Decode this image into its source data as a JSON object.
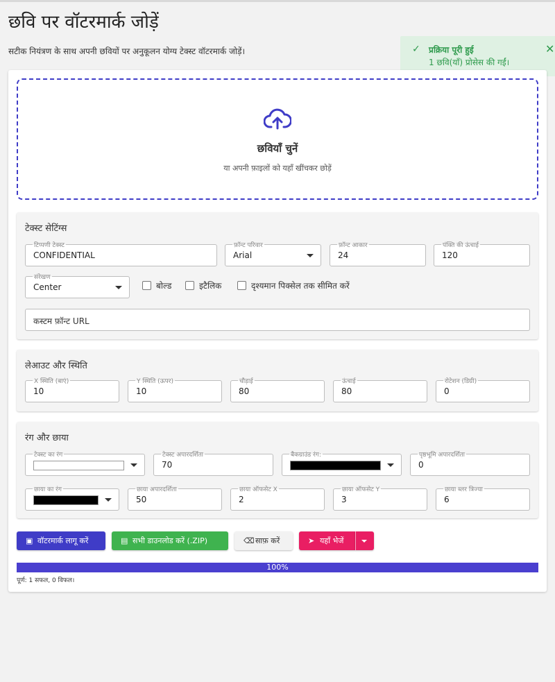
{
  "page": {
    "title": "छवि पर वॉटरमार्क जोड़ें",
    "description": "सटीक नियंत्रण के साथ अपनी छवियों पर अनुकूलन योग्य टेक्स्ट वॉटरमार्क जोड़ें।"
  },
  "toast": {
    "title": "प्रक्रिया पूरी हुई",
    "message": "1 छवि(याँ) प्रोसेस की गईं।",
    "close_icon": "close-icon",
    "check_icon": "check-icon"
  },
  "dropzone": {
    "icon": "cloud-upload-icon",
    "title": "छवियाँ चुनें",
    "subtitle": "या अपनी फ़ाइलों को यहाँ खींचकर छोड़ें"
  },
  "text_settings": {
    "title": "टेक्स्ट सेटिंग्स",
    "comment_text": {
      "label": "टिप्पणी टेक्स्ट",
      "value": "CONFIDENTIAL"
    },
    "font_family": {
      "label": "फ़ॉन्ट परिवार",
      "value": "Arial"
    },
    "font_size": {
      "label": "फ़ॉन्ट आकार",
      "value": "24"
    },
    "line_height": {
      "label": "पंक्ति की ऊंचाई",
      "value": "120"
    },
    "alignment": {
      "label": "संरेखण",
      "value": "Center"
    },
    "bold": {
      "label": "बोल्ड",
      "checked": false
    },
    "italic": {
      "label": "इटैलिक",
      "checked": false
    },
    "clip": {
      "label": "दृश्यमान पिक्सेल तक सीमित करें",
      "checked": false
    },
    "custom_font_url": {
      "placeholder": "कस्टम फ़ॉन्ट URL",
      "value": ""
    }
  },
  "layout": {
    "title": "लेआउट और स्थिति",
    "x_pos": {
      "label": "X स्थिति (बाएं)",
      "value": "10"
    },
    "y_pos": {
      "label": "Y स्थिति (ऊपर)",
      "value": "10"
    },
    "width": {
      "label": "चौड़ाई",
      "value": "80"
    },
    "height": {
      "label": "ऊंचाई",
      "value": "80"
    },
    "rotation": {
      "label": "रोटेशन (डिग्री)",
      "value": "0"
    }
  },
  "color": {
    "title": "रंग और छाया",
    "text_color": {
      "label": "टेक्स्ट का रंग",
      "color": "#ffffff"
    },
    "text_opacity": {
      "label": "टेक्स्ट अपारदर्शिता",
      "value": "70"
    },
    "bg_color": {
      "label": "बैकग्राउंड रंग:",
      "color": "#000000"
    },
    "bg_opacity": {
      "label": "पृष्ठभूमि अपारदर्शिता",
      "value": "0"
    },
    "shadow_color": {
      "label": "छाया का रंग",
      "color": "#000000"
    },
    "shadow_opacity": {
      "label": "छाया अपारदर्शिता",
      "value": "50"
    },
    "shadow_offset_x": {
      "label": "छाया ऑफसेट X",
      "value": "2"
    },
    "shadow_offset_y": {
      "label": "छाया ऑफसेट Y",
      "value": "3"
    },
    "shadow_radius": {
      "label": "छाया ब्लर त्रिज्या",
      "value": "6"
    }
  },
  "actions": {
    "apply": {
      "label": "वॉटरमार्क लागू करें",
      "icon": "image-icon",
      "color": "#3f3cc7"
    },
    "download": {
      "label": "सभी डाउनलोड करें (.ZIP)",
      "icon": "folder-zip-icon",
      "color": "#3fb34f"
    },
    "clear": {
      "label": "साफ़ करें",
      "icon": "eraser-icon"
    },
    "send": {
      "label": "यहाँ भेजें",
      "icon": "send-icon",
      "color": "#e91e63"
    }
  },
  "progress": {
    "percent": 100,
    "label": "100%"
  },
  "summary": "पूर्ण: 1 सफल, 0 विफल।"
}
